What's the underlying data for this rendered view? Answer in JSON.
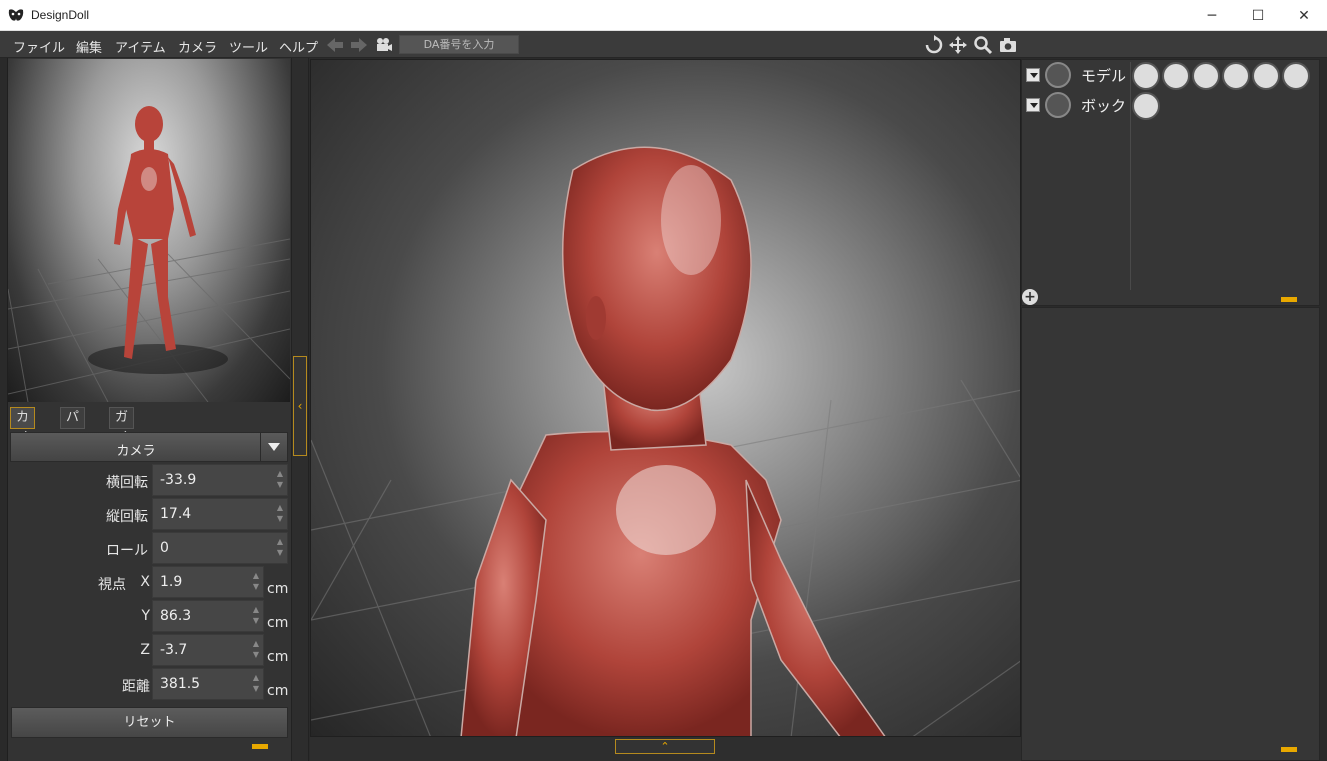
{
  "window": {
    "title": "DesignDoll",
    "minimize": "─",
    "maximize": "☐",
    "close": "✕"
  },
  "menu": {
    "items": [
      "ファイル",
      "編集",
      "アイテム",
      "カメラ",
      "ツール",
      "ヘルプ"
    ],
    "da_placeholder": "DA番号を入力"
  },
  "left_panel": {
    "tabs": [
      "カメラ",
      "パース",
      "ガイド"
    ],
    "active_tab": "カメラ",
    "camera_select": "カメラ",
    "fields": {
      "yaw": {
        "label": "横回転",
        "value": "-33.9"
      },
      "pitch": {
        "label": "縦回転",
        "value": "17.4"
      },
      "roll": {
        "label": "ロール",
        "value": "0"
      },
      "viewpoint_label": "視点",
      "x": {
        "label": "X",
        "value": "1.9",
        "unit": "cm"
      },
      "y": {
        "label": "Y",
        "value": "86.3",
        "unit": "cm"
      },
      "z": {
        "label": "Z",
        "value": "-3.7",
        "unit": "cm"
      },
      "distance": {
        "label": "距離",
        "value": "381.5",
        "unit": "cm"
      }
    },
    "reset_label": "リセット"
  },
  "scene_tree": {
    "items": [
      {
        "name": "モデル"
      },
      {
        "name": "ボック"
      }
    ]
  },
  "icons": {
    "toolbar": [
      "undo-arrow-icon",
      "redo-arrow-icon",
      "camera-record-icon"
    ],
    "view_tools": [
      "rotate-view-icon",
      "pan-view-icon",
      "zoom-view-icon",
      "screenshot-icon"
    ],
    "model_tools": [
      "body-icon",
      "pose-icon",
      "zoom-part-icon",
      "select-part-icon",
      "hand-icon",
      "foot-icon"
    ],
    "box_tools": [
      "cube-icon"
    ]
  },
  "colors": {
    "accent": "#e8a800",
    "doll": "#b8443a",
    "panel": "#363636"
  }
}
